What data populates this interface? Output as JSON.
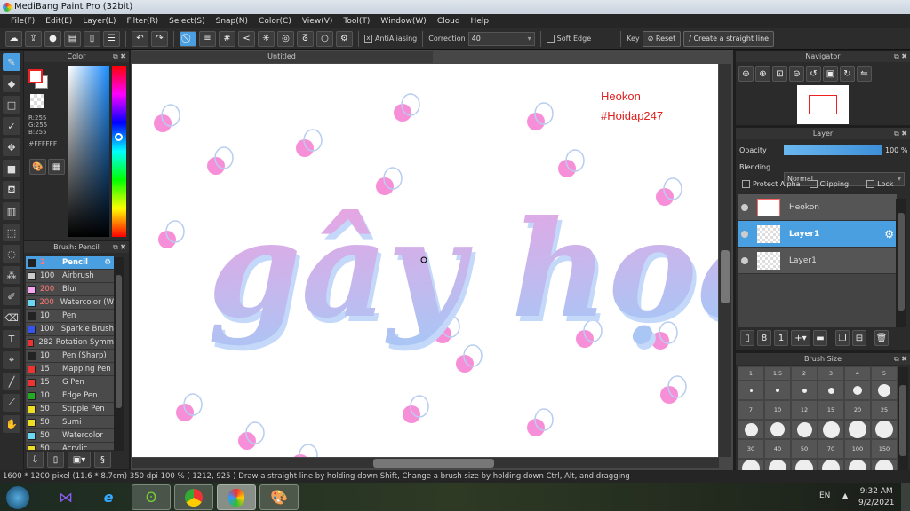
{
  "window": {
    "title": "MediBang Paint Pro (32bit)"
  },
  "menu": [
    "File(F)",
    "Edit(E)",
    "Layer(L)",
    "Filter(R)",
    "Select(S)",
    "Snap(N)",
    "Color(C)",
    "View(V)",
    "Tool(T)",
    "Window(W)",
    "Cloud",
    "Help"
  ],
  "toolbar": {
    "antialiasing": "AntiAliasing",
    "correction_label": "Correction",
    "correction_value": "40",
    "soft_edge": "Soft Edge",
    "key": "Key",
    "reset": "Reset",
    "straight_line": "Create a straight line"
  },
  "canvas": {
    "tab": "Untitled",
    "watermark_line1": "Heokon",
    "watermark_line2": "#Hoidap247",
    "art_text": "gây họa"
  },
  "color_panel": {
    "title": "Color",
    "r": "R:255",
    "g": "G:255",
    "b": "B:255",
    "hex": "#FFFFFF"
  },
  "brush_panel": {
    "title": "Brush: Pencil",
    "items": [
      {
        "size": "2",
        "name": "Pencil",
        "color": "#222222",
        "selected": true
      },
      {
        "size": "100",
        "name": "Airbrush",
        "color": "#cccccc"
      },
      {
        "size": "200",
        "name": "Blur",
        "color": "#f4a6f0"
      },
      {
        "size": "200",
        "name": "Watercolor (W",
        "color": "#6ad8f0"
      },
      {
        "size": "10",
        "name": "Pen",
        "color": "#222222"
      },
      {
        "size": "100",
        "name": "Sparkle Brush",
        "color": "#3355ee"
      },
      {
        "size": "282",
        "name": "Rotation Symm",
        "color": "#ee3333"
      },
      {
        "size": "10",
        "name": "Pen (Sharp)",
        "color": "#222222"
      },
      {
        "size": "15",
        "name": "Mapping Pen",
        "color": "#ee3333"
      },
      {
        "size": "15",
        "name": "G Pen",
        "color": "#ee3333"
      },
      {
        "size": "10",
        "name": "Edge Pen",
        "color": "#22aa22"
      },
      {
        "size": "50",
        "name": "Stipple Pen",
        "color": "#eedd22"
      },
      {
        "size": "50",
        "name": "Sumi",
        "color": "#eedd22"
      },
      {
        "size": "50",
        "name": "Watercolor",
        "color": "#6ad8f0"
      },
      {
        "size": "50",
        "name": "Acrylic",
        "color": "#eedd22"
      }
    ]
  },
  "navigator": {
    "title": "Navigator"
  },
  "layer_panel": {
    "title": "Layer",
    "opacity_label": "Opacity",
    "opacity_value": "100 %",
    "opacity": 100,
    "blending_label": "Blending",
    "blending_value": "Normal",
    "protect_alpha": "Protect Alpha",
    "clipping": "Clipping",
    "lock": "Lock",
    "layers": [
      {
        "name": "Heokon",
        "selected": false
      },
      {
        "name": "Layer1",
        "selected": true
      },
      {
        "name": "Layer1",
        "selected": false
      }
    ]
  },
  "brush_size_panel": {
    "title": "Brush Size",
    "sizes": [
      "1",
      "1.5",
      "2",
      "3",
      "4",
      "5",
      "7",
      "10",
      "12",
      "15",
      "20",
      "25",
      "30",
      "40",
      "50",
      "70",
      "100",
      "150"
    ]
  },
  "status": {
    "text": "1600 * 1200 pixel   (11.6 * 8.7cm)   350 dpi   100 %   ( 1212, 925 )   Draw a straight line by holding down Shift, Change a brush size by holding down Ctrl, Alt, and dragging"
  },
  "taskbar": {
    "lang": "EN",
    "time": "9:32 AM",
    "date": "9/2/2021"
  },
  "colors": {
    "accent": "#4a9fe0",
    "pink": "#f78fd8",
    "blue": "#a9c6f5"
  }
}
